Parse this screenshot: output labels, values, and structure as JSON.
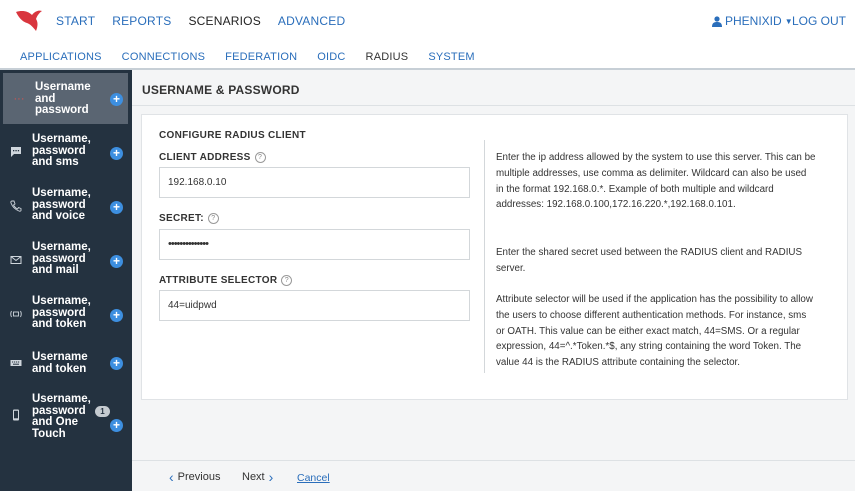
{
  "colors": {
    "accent": "#2a6ebb",
    "sidebar_bg": "#243240",
    "plus_button": "#3d8fe0",
    "logo": "#d9363e"
  },
  "topnav": {
    "items": [
      "START",
      "REPORTS",
      "SCENARIOS",
      "ADVANCED"
    ],
    "active": "SCENARIOS",
    "user": "PHENIXID",
    "logout": "LOG OUT"
  },
  "subnav": {
    "items": [
      "APPLICATIONS",
      "CONNECTIONS",
      "FEDERATION",
      "OIDC",
      "RADIUS",
      "SYSTEM"
    ],
    "active": "RADIUS"
  },
  "sidebar": {
    "items": [
      {
        "label": "Username\nand\npassword",
        "icon": "dots-icon",
        "active": true
      },
      {
        "label": "Username,\npassword\nand sms",
        "icon": "message-icon"
      },
      {
        "label": "Username,\npassword\nand voice",
        "icon": "phone-icon"
      },
      {
        "label": "Username,\npassword\nand mail",
        "icon": "mail-icon"
      },
      {
        "label": "Username,\npassword\nand token",
        "icon": "token-icon"
      },
      {
        "label": "Username\nand token",
        "icon": "keyboard-icon"
      },
      {
        "label": "Username,\npassword\nand One\nTouch",
        "icon": "mobile-icon",
        "badge": "1"
      }
    ]
  },
  "main": {
    "title": "USERNAME & PASSWORD",
    "section_title": "CONFIGURE RADIUS CLIENT",
    "client_address_label": "CLIENT ADDRESS",
    "client_address_value": "192.168.0.10",
    "secret_label": "SECRET:",
    "secret_value": "••••••••••••••",
    "attribute_selector_label": "ATTRIBUTE SELECTOR",
    "attribute_selector_value": "44=uidpwd",
    "help_client_address": "Enter the ip address allowed by the system to use this server. This can be multiple addresses, use comma as delimiter. Wildcard can also be used in the format 192.168.0.*. Example of both multiple and wildcard addresses: 192.168.0.100,172.16.220.*,192.168.0.101.",
    "help_secret": "Enter the shared secret used between the RADIUS client and RADIUS server.",
    "help_attribute": "Attribute selector will be used if the application has the possibility to allow the users to choose different authentication methods. For instance, sms or OATH. This value can be either exact match, 44=SMS. Or a regular expression, 44=^.*Token.*$, any string containing the word Token. The value 44 is the RADIUS attribute containing the selector."
  },
  "footer": {
    "previous": "Previous",
    "next": "Next",
    "cancel": "Cancel"
  }
}
